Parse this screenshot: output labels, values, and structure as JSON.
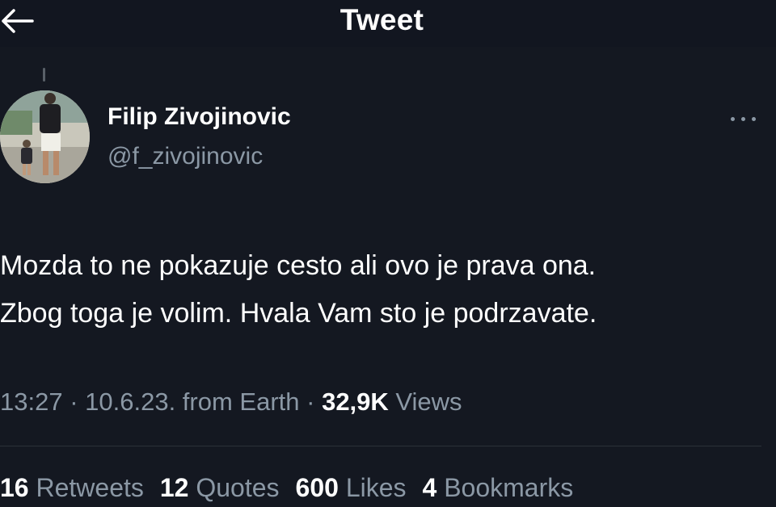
{
  "header": {
    "title": "Tweet"
  },
  "author": {
    "display_name": "Filip Zivojinovic",
    "handle": "@f_zivojinovic"
  },
  "tweet": {
    "lines": [
      "Mozda to ne pokazuje cesto ali ovo je prava ona.",
      "Zbog toga je volim. Hvala Vam sto je podrzavate."
    ]
  },
  "meta": {
    "time": "13:27",
    "sep1": " · ",
    "date": "10.6.23.",
    "source": " from Earth",
    "sep2": " · ",
    "views_count": "32,9K",
    "views_label": " Views"
  },
  "stats": {
    "retweets_count": "16",
    "retweets_label": " Retweets",
    "quotes_count": "12",
    "quotes_label": " Quotes",
    "likes_count": "600",
    "likes_label": " Likes",
    "bookmarks_count": "4",
    "bookmarks_label": " Bookmarks"
  },
  "icons": {
    "back": "arrow-left-icon",
    "more": "more-horizontal-icon"
  },
  "colors": {
    "background": "#141821",
    "text_primary": "#ffffff",
    "text_secondary": "#8b98a5"
  }
}
